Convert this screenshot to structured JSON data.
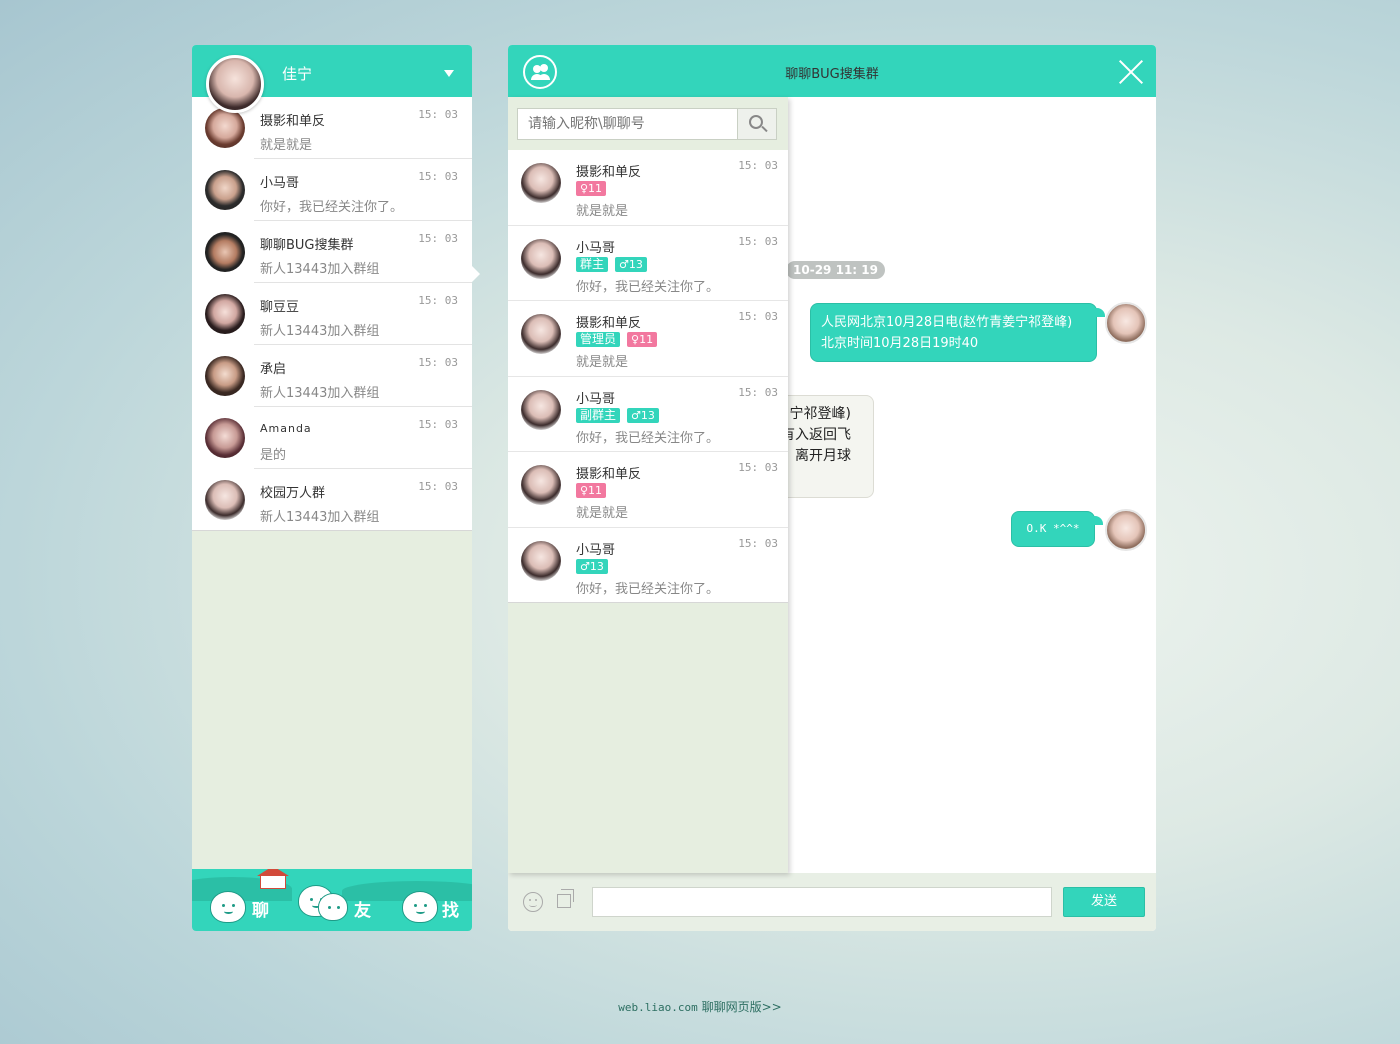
{
  "user": {
    "name": "佳宁"
  },
  "conversations": [
    {
      "name": "摄影和单反",
      "time": "15: 03",
      "preview": "就是就是"
    },
    {
      "name": "小马哥",
      "time": "15: 03",
      "preview": "你好，我已经关注你了。"
    },
    {
      "name": "聊聊BUG搜集群",
      "time": "15: 03",
      "preview": "新人13443加入群组"
    },
    {
      "name": "聊豆豆",
      "time": "15: 03",
      "preview": "新人13443加入群组"
    },
    {
      "name": "承启",
      "time": "15: 03",
      "preview": "新人13443加入群组"
    },
    {
      "name": "Amanda",
      "time": "15: 03",
      "preview": "是的"
    },
    {
      "name": "校园万人群",
      "time": "15: 03",
      "preview": "新人13443加入群组"
    }
  ],
  "footer_tabs": [
    "聊",
    "友",
    "找"
  ],
  "chat": {
    "title": "聊聊BUG搜集群",
    "search_placeholder": "请输入昵称\\聊聊号",
    "members": [
      {
        "name": "摄影和单反",
        "time": "15: 03",
        "badges": [
          "♀11"
        ],
        "preview": "就是就是"
      },
      {
        "name": "小马哥",
        "time": "15: 03",
        "badges": [
          "群主",
          "♂13"
        ],
        "preview": "你好，我已经关注你了。"
      },
      {
        "name": "摄影和单反",
        "time": "15: 03",
        "badges": [
          "管理员",
          "♀11"
        ],
        "preview": "就是就是"
      },
      {
        "name": "小马哥",
        "time": "15: 03",
        "badges": [
          "副群主",
          "♂13"
        ],
        "preview": "你好，我已经关注你了。"
      },
      {
        "name": "摄影和单反",
        "time": "15: 03",
        "badges": [
          "♀11"
        ],
        "preview": "就是就是"
      },
      {
        "name": "小马哥",
        "time": "15: 03",
        "badges": [
          "♂13"
        ],
        "preview": "你好，我已经关注你了。"
      }
    ],
    "timestamp": "10-29 11: 19",
    "messages": {
      "out1_line1": "人民网北京10月28日电(赵竹青姜宁祁登峰)",
      "out1_line2": "北京时间10月28日19时40",
      "in1_line1": "宁祁登峰)",
      "in1_line2": "有入返回飞",
      "in1_line3": "离开月球",
      "out2": "O.K *^^*"
    },
    "send_label": "发送"
  },
  "footer": {
    "url": "web.liao.com",
    "link": "聊聊网页版>>"
  },
  "colors": {
    "accent": "#33d5bb",
    "female": "#f2789f"
  }
}
